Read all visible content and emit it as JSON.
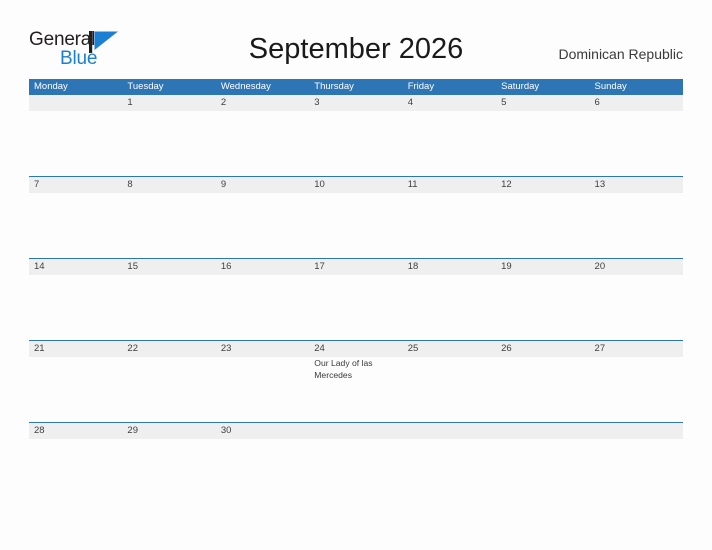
{
  "brand": {
    "word1": "General",
    "word2": "Blue",
    "flag_icon": "blue-flag-triangle",
    "color_dark": "#231f20",
    "color_blue": "#1b7fd4"
  },
  "header": {
    "title": "September 2026",
    "country": "Dominican Republic"
  },
  "calendar": {
    "accent_color": "#2e75b6",
    "date_band_color": "#efefef",
    "day_headers": [
      "Monday",
      "Tuesday",
      "Wednesday",
      "Thursday",
      "Friday",
      "Saturday",
      "Sunday"
    ],
    "weeks": [
      {
        "dates": [
          "",
          "1",
          "2",
          "3",
          "4",
          "5",
          "6"
        ],
        "events": [
          "",
          "",
          "",
          "",
          "",
          "",
          ""
        ]
      },
      {
        "dates": [
          "7",
          "8",
          "9",
          "10",
          "11",
          "12",
          "13"
        ],
        "events": [
          "",
          "",
          "",
          "",
          "",
          "",
          ""
        ]
      },
      {
        "dates": [
          "14",
          "15",
          "16",
          "17",
          "18",
          "19",
          "20"
        ],
        "events": [
          "",
          "",
          "",
          "",
          "",
          "",
          ""
        ]
      },
      {
        "dates": [
          "21",
          "22",
          "23",
          "24",
          "25",
          "26",
          "27"
        ],
        "events": [
          "",
          "",
          "",
          "Our Lady of las Mercedes",
          "",
          "",
          ""
        ]
      },
      {
        "dates": [
          "28",
          "29",
          "30",
          "",
          "",
          "",
          ""
        ],
        "events": [
          "",
          "",
          "",
          "",
          "",
          "",
          ""
        ]
      }
    ]
  }
}
